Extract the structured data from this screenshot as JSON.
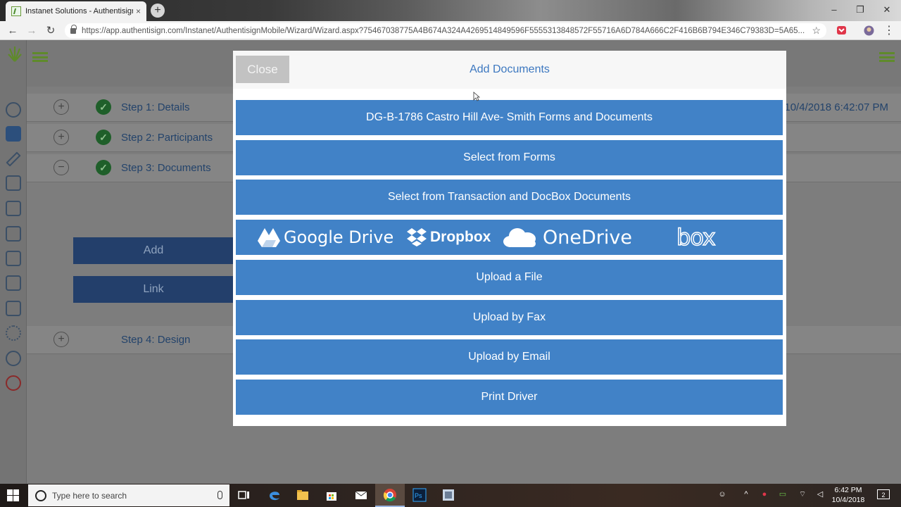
{
  "browser": {
    "tab_title": "Instanet Solutions - Authentisign",
    "tab_close": "×",
    "new_tab": "+",
    "url": "https://app.authentisign.com/Instanet/AuthentisignMobile/Wizard/Wizard.aspx?75467038775A4B674A324A4269514849596F5555313848572F55716A6D784A666C2F416B6B794E346C79383D=5A65...",
    "win_minimize": "–",
    "win_restore": "❐",
    "win_close": "✕",
    "back": "←",
    "forward": "→",
    "reload": "↻",
    "bookmark": "☆",
    "menu": "⋮"
  },
  "steps": [
    {
      "label": "Step 1: Details",
      "toggle": "+",
      "check": "✓"
    },
    {
      "label": "Step 2: Participants",
      "toggle": "+",
      "check": "✓"
    },
    {
      "label": "Step 3: Documents",
      "toggle": "−",
      "check": "✓"
    },
    {
      "label": "Step 4: Design",
      "toggle": "+"
    }
  ],
  "step1_date": "10/4/2018 6:42:07 PM",
  "side_buttons": {
    "add": "Add",
    "link": "Link"
  },
  "modal": {
    "close_label": "Close",
    "title": "Add Documents",
    "buttons": [
      "DG-B-1786 Castro Hill Ave- Smith Forms and Documents",
      "Select from Forms",
      "Select from Transaction and DocBox Documents"
    ],
    "cloud_services": [
      "Google Drive",
      "Dropbox",
      "OneDrive",
      "box"
    ],
    "upload_buttons": [
      "Upload a File",
      "Upload by Fax",
      "Upload by Email",
      "Print Driver"
    ]
  },
  "taskbar": {
    "search_placeholder": "Type here to search",
    "time": "6:42 PM",
    "date": "10/4/2018",
    "notifications": "2"
  },
  "colors": {
    "modal_button": "#4182c7",
    "modal_title": "#3d78c0",
    "brand_green": "#5f8a2b"
  }
}
